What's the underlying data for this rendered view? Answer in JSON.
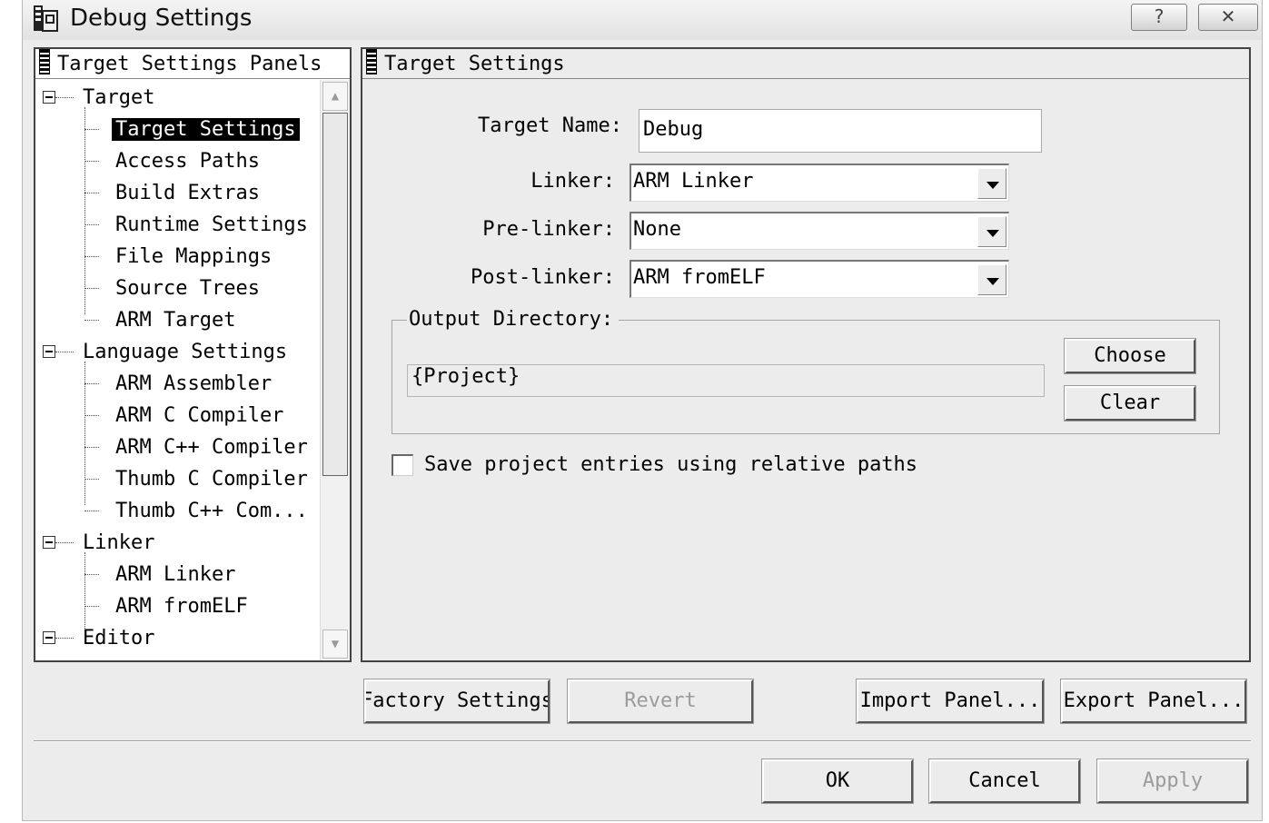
{
  "window": {
    "title": "Debug Settings",
    "help_button": "?",
    "close_button": "✕"
  },
  "left_panel": {
    "header": "Target Settings Panels",
    "tree": [
      {
        "label": "Target",
        "level": 0,
        "expanded": true
      },
      {
        "label": "Target Settings",
        "level": 1,
        "selected": true
      },
      {
        "label": "Access Paths",
        "level": 1
      },
      {
        "label": "Build Extras",
        "level": 1
      },
      {
        "label": "Runtime Settings",
        "level": 1
      },
      {
        "label": "File Mappings",
        "level": 1
      },
      {
        "label": "Source Trees",
        "level": 1
      },
      {
        "label": "ARM Target",
        "level": 1
      },
      {
        "label": "Language Settings",
        "level": 0,
        "expanded": true
      },
      {
        "label": "ARM Assembler",
        "level": 1
      },
      {
        "label": "ARM C Compiler",
        "level": 1
      },
      {
        "label": "ARM C++ Compiler",
        "level": 1
      },
      {
        "label": "Thumb C Compiler",
        "level": 1
      },
      {
        "label": "Thumb C++ Com...",
        "level": 1
      },
      {
        "label": "Linker",
        "level": 0,
        "expanded": true
      },
      {
        "label": "ARM Linker",
        "level": 1
      },
      {
        "label": "ARM fromELF",
        "level": 1
      },
      {
        "label": "Editor",
        "level": 0,
        "expanded": true
      }
    ]
  },
  "right_panel": {
    "header": "Target Settings",
    "target_name_label": "Target Name:",
    "target_name_value": "Debug",
    "linker_label": "Linker:",
    "linker_value": "ARM Linker",
    "prelinker_label": "Pre-linker:",
    "prelinker_value": "None",
    "postlinker_label": "Post-linker:",
    "postlinker_value": "ARM fromELF",
    "output_directory_label": "Output Directory:",
    "output_directory_value": "{Project}",
    "choose_button": "Choose",
    "clear_button": "Clear",
    "relative_paths_label": "Save project entries using relative paths",
    "relative_paths_checked": false
  },
  "panel_buttons": {
    "factory_settings": "Factory Settings",
    "revert": "Revert",
    "import_panel": "Import Panel...",
    "export_panel": "Export Panel..."
  },
  "dialog_buttons": {
    "ok": "OK",
    "cancel": "Cancel",
    "apply": "Apply"
  }
}
